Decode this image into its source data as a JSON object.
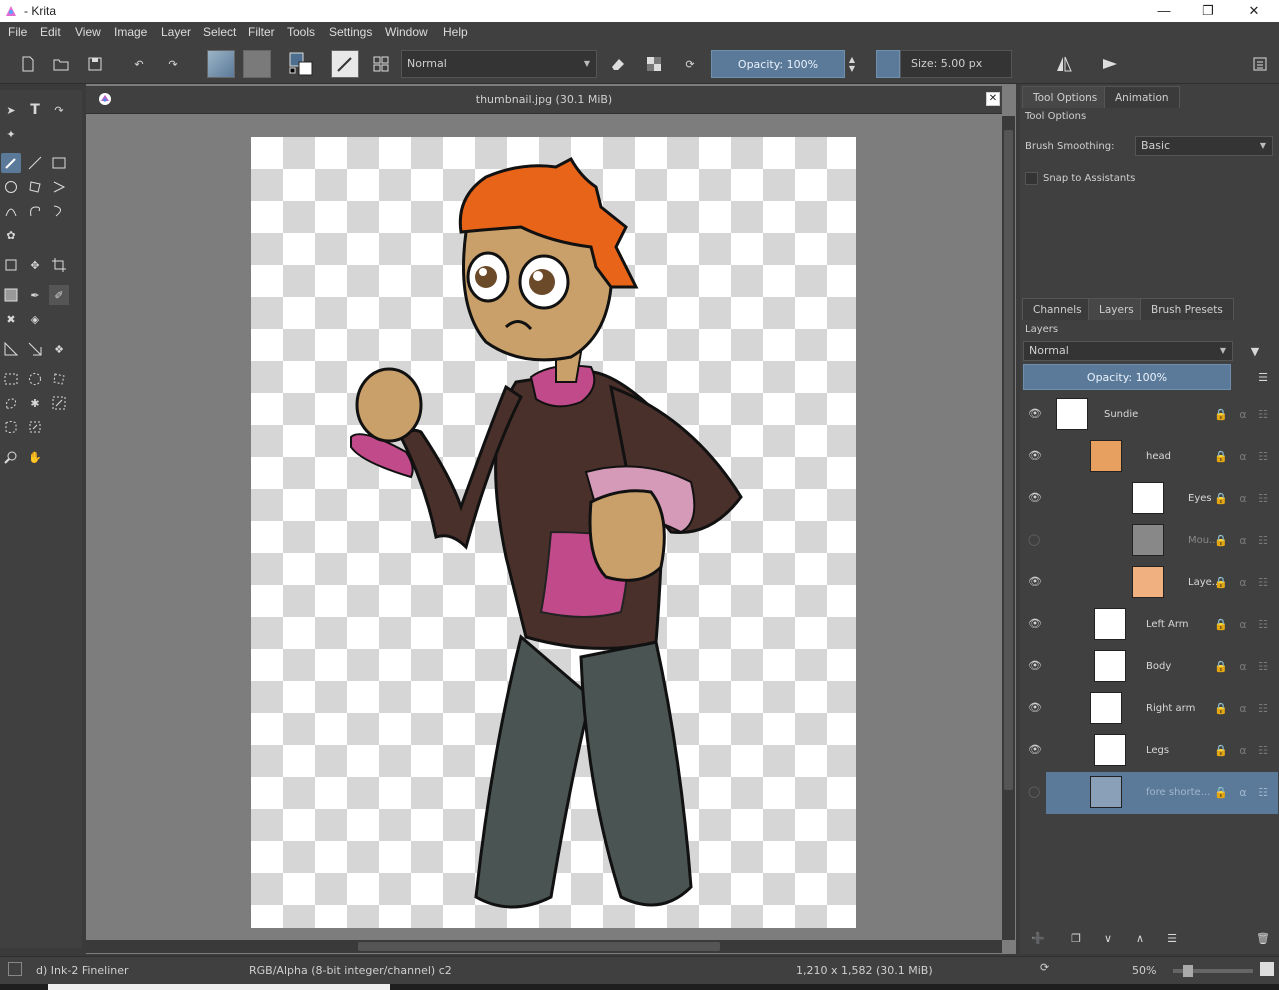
{
  "window": {
    "title": "- Krita"
  },
  "menu": [
    "File",
    "Edit",
    "View",
    "Image",
    "Layer",
    "Select",
    "Filter",
    "Tools",
    "Settings",
    "Window",
    "Help"
  ],
  "toolbar": {
    "blend_mode": "Normal",
    "opacity_label": "Opacity: 100%",
    "size_label": "Size: 5.00 px"
  },
  "document": {
    "tab_title": "thumbnail.jpg (30.1 MiB)"
  },
  "tool_options": {
    "tabs": [
      "Tool Options",
      "Animation"
    ],
    "header": "Tool Options",
    "brush_smoothing_label": "Brush Smoothing:",
    "brush_smoothing_value": "Basic",
    "snap_label": "Snap to Assistants"
  },
  "layers_panel": {
    "tabs": [
      "Channels",
      "Layers",
      "Brush Presets"
    ],
    "header": "Layers",
    "blend_mode": "Normal",
    "opacity_label": "Opacity:  100%",
    "layers": [
      {
        "name": "Sundie",
        "visible": true
      },
      {
        "name": "head",
        "visible": true
      },
      {
        "name": "Eyes",
        "visible": true
      },
      {
        "name": "Mou...",
        "visible": false
      },
      {
        "name": "Laye...",
        "visible": true
      },
      {
        "name": "Left Arm",
        "visible": true
      },
      {
        "name": "Body",
        "visible": true
      },
      {
        "name": "Right arm",
        "visible": true
      },
      {
        "name": "Legs",
        "visible": true
      },
      {
        "name": "fore shorte...",
        "visible": false,
        "selected": true
      }
    ]
  },
  "status": {
    "brush": "d) Ink-2 Fineliner",
    "color_space": "RGB/Alpha (8-bit integer/channel)  c2",
    "image_size": "1,210 x 1,582 (30.1 MiB)",
    "zoom": "50%"
  },
  "colors": {
    "accent": "#5b7a9a",
    "panel": "#404040",
    "canvas_bg": "#7d7d7d"
  }
}
